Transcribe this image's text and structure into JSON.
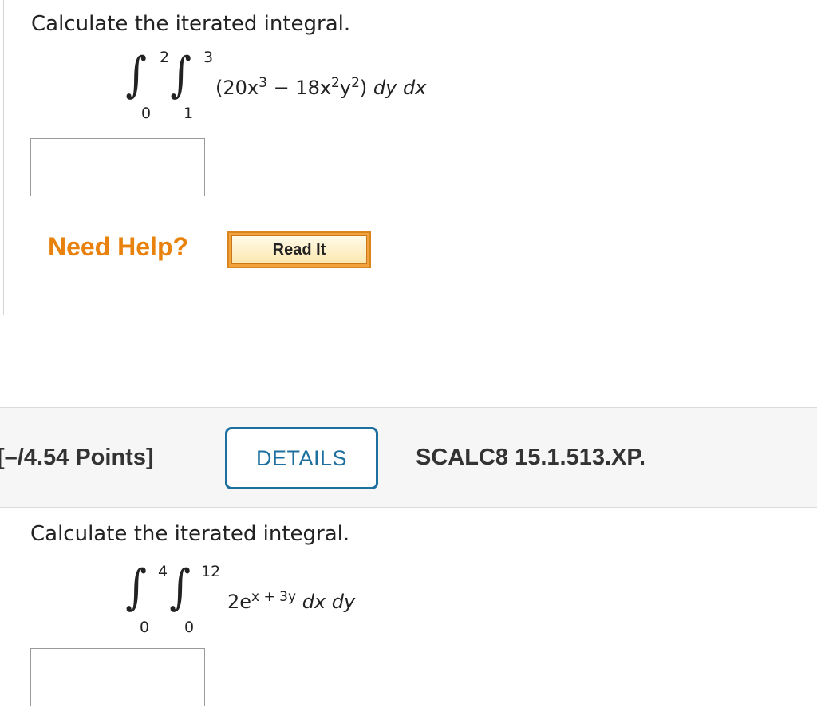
{
  "question1": {
    "prompt": "Calculate the iterated integral.",
    "outer_upper": "2",
    "outer_lower": "0",
    "inner_upper": "3",
    "inner_lower": "1",
    "integrand_open": "(20x",
    "integrand_exp1": "3",
    "integrand_mid": " − 18x",
    "integrand_exp2": "2",
    "integrand_y": "y",
    "integrand_exp3": "2",
    "integrand_close": ") ",
    "differentials": "dy dx",
    "answer_value": "",
    "need_help": "Need Help?",
    "read_it": "Read It"
  },
  "question2": {
    "points": "[–/4.54 Points]",
    "details": "DETAILS",
    "code": "SCALC8 15.1.513.XP.",
    "prompt": "Calculate the iterated integral.",
    "outer_upper": "4",
    "outer_lower": "0",
    "inner_upper": "12",
    "inner_lower": "0",
    "integrand_base": "2e",
    "integrand_exp": "x + 3y",
    "differentials": "dx dy",
    "answer_value": ""
  },
  "colors": {
    "help_orange": "#e8820c",
    "details_blue": "#1d6f9e"
  }
}
